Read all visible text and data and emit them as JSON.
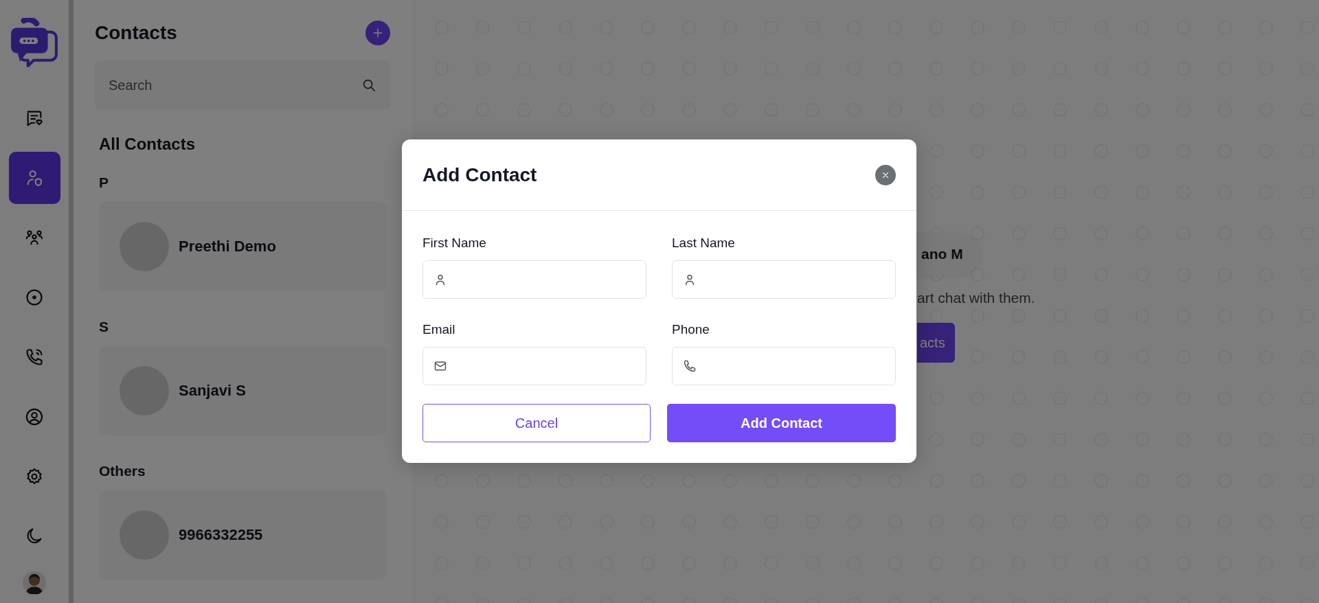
{
  "sidebar": {
    "nav": [
      {
        "kind": "chats",
        "selected": false
      },
      {
        "kind": "contacts",
        "selected": true
      },
      {
        "kind": "groups",
        "selected": false
      },
      {
        "kind": "status",
        "selected": false
      },
      {
        "kind": "calls",
        "selected": false
      },
      {
        "kind": "profile",
        "selected": false
      },
      {
        "kind": "settings",
        "selected": false
      },
      {
        "kind": "theme",
        "selected": false
      }
    ]
  },
  "contacts_panel": {
    "title": "Contacts",
    "search": {
      "placeholder": "Search"
    },
    "heading": "All Contacts",
    "groups": [
      {
        "letter": "P",
        "contacts": [
          {
            "name": "Preethi Demo"
          }
        ]
      },
      {
        "letter": "S",
        "contacts": [
          {
            "name": "Sanjavi S"
          }
        ]
      },
      {
        "letter": "Others",
        "contacts": [
          {
            "name": "9966332255"
          }
        ]
      }
    ]
  },
  "background": {
    "user_chip": "ano M",
    "hint": "art chat with them.",
    "button": "acts"
  },
  "dialog": {
    "title": "Add Contact",
    "fields": [
      {
        "label": "First Name",
        "kind": "person"
      },
      {
        "label": "Last Name",
        "kind": "person"
      },
      {
        "label": "Email",
        "kind": "email"
      },
      {
        "label": "Phone",
        "kind": "phone"
      }
    ],
    "buttons": [
      {
        "label": "Cancel",
        "kind": "secondary"
      },
      {
        "label": "Add Contact",
        "kind": "primary"
      }
    ]
  }
}
